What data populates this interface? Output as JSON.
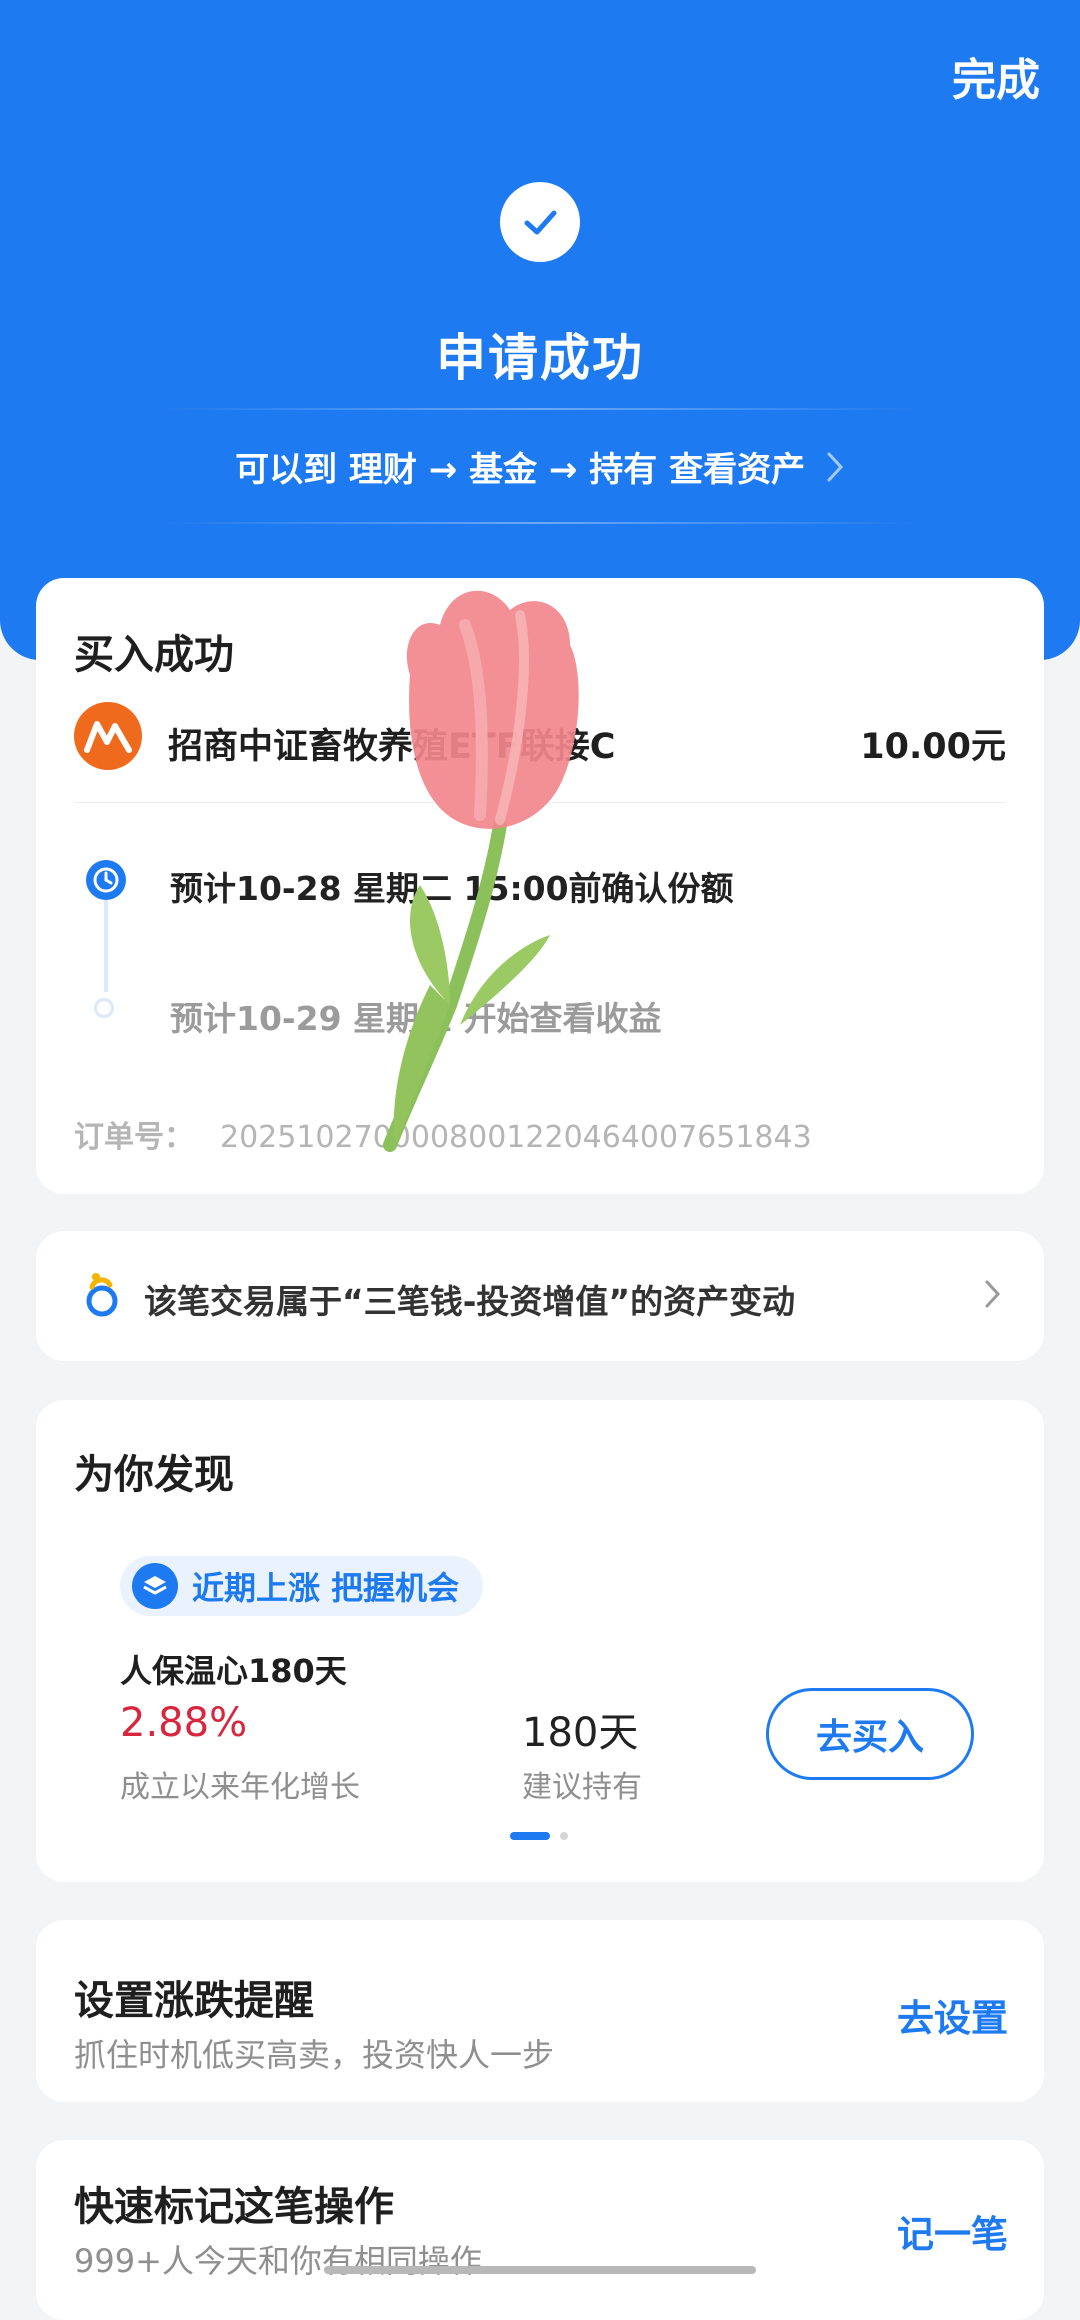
{
  "header": {
    "done_label": "完成",
    "status_title": "申请成功",
    "nav_hint": "可以到 理财 → 基金 → 持有 查看资产"
  },
  "order": {
    "title": "买入成功",
    "fund_name": "招商中证畜牧养殖ETF联接C",
    "amount": "10.00元",
    "steps": [
      {
        "text": "预计10-28 星期二 15:00前确认份额",
        "active": true
      },
      {
        "text": "预计10-29 星期三 开始查看收益",
        "active": false
      }
    ],
    "order_no_label": "订单号：",
    "order_no": "2025102700008001220464007651843"
  },
  "asset_change": {
    "text": "该笔交易属于“三笔钱-投资增值”的资产变动",
    "icon": "three-money-icon"
  },
  "discover": {
    "title": "为你发现",
    "tag": "近期上涨 把握机会",
    "product_name": "人保温心180天",
    "rate": "2.88%",
    "rate_label": "成立以来年化增长",
    "hold_days": "180天",
    "hold_label": "建议持有",
    "buy_label": "去买入",
    "pager": {
      "total": 2,
      "current": 1
    }
  },
  "alert": {
    "title": "设置涨跌提醒",
    "subtitle": "抓住时机低买高卖，投资快人一步",
    "action": "去设置"
  },
  "mark": {
    "title": "快速标记这笔操作",
    "subtitle": "999+人今天和你有相同操作",
    "action": "记一笔"
  },
  "colors": {
    "brand_blue": "#1e7af0",
    "rate_red": "#d7263d",
    "fund_logo_orange": "#f06a1d"
  }
}
